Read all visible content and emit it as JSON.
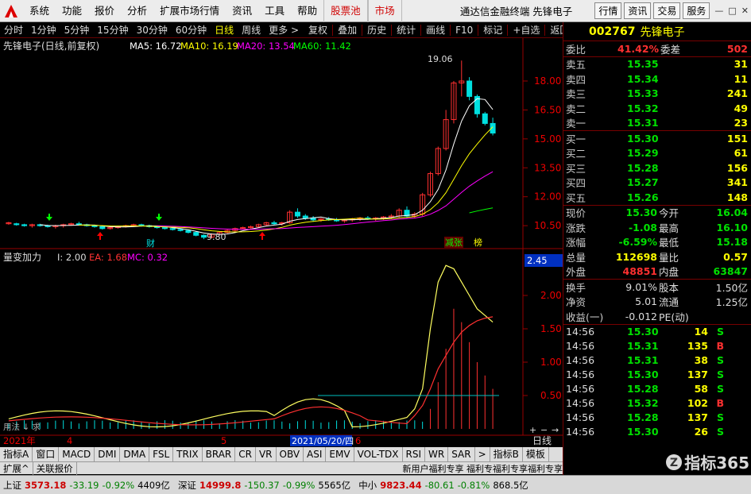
{
  "menu": {
    "items": [
      "系统",
      "功能",
      "报价",
      "分析",
      "扩展市场行情",
      "资讯",
      "工具",
      "帮助"
    ],
    "red_items": [
      "股票池",
      "市场"
    ],
    "title": "通达信金融终端  先锋电子",
    "right_buttons": [
      "行情",
      "资讯",
      "交易",
      "服务"
    ]
  },
  "toolbar": {
    "items": [
      "分时",
      "1分钟",
      "5分钟",
      "15分钟",
      "30分钟",
      "60分钟",
      "日线",
      "周线",
      "更多 >"
    ],
    "selected": "日线",
    "items2": [
      "复权",
      "叠加",
      "历史",
      "统计",
      "画线",
      "F10",
      "标记",
      "+自选",
      "返回"
    ]
  },
  "chart": {
    "title": "先锋电子(日线,前复权)",
    "ma5": "MA5: 16.72",
    "ma10": "MA10: 16.19",
    "ma20": "MA20: 13.54",
    "ma60": "MA60: 11.42",
    "price_ticks": [
      "18.00",
      "16.50",
      "15.00",
      "13.50",
      "12.00",
      "10.50"
    ],
    "high_label": "19.06",
    "low_label": "9.80",
    "cai_label": "财",
    "tag1": "减张",
    "tag2": "榜",
    "ind_title": "量变加力",
    "ind_i": "I: 2.00",
    "ind_ea": "EA: 1.68",
    "ind_mc": "MC: 0.32",
    "ind_ticks": [
      "2.00",
      "1.50",
      "1.00",
      "0.50"
    ],
    "ind_top": "2.45",
    "date_labels": [
      "2021年",
      "4",
      "5",
      "6"
    ],
    "date_box": "2021/05/20/四",
    "period": "日线",
    "bottom_label": "用法 ↓ 求",
    "bottom_icons": [
      "+",
      "−",
      "→"
    ]
  },
  "chart_data": {
    "type": "candlestick",
    "candles": [
      [
        10.6,
        10.7,
        10.55,
        10.65
      ],
      [
        10.6,
        10.65,
        10.5,
        10.55
      ],
      [
        10.55,
        10.6,
        10.45,
        10.5
      ],
      [
        10.5,
        10.6,
        10.4,
        10.55
      ],
      [
        10.55,
        10.6,
        10.45,
        10.5
      ],
      [
        10.5,
        10.55,
        10.4,
        10.45
      ],
      [
        10.45,
        10.55,
        10.35,
        10.5
      ],
      [
        10.5,
        10.6,
        10.4,
        10.55
      ],
      [
        10.55,
        10.65,
        10.5,
        10.6
      ],
      [
        10.6,
        10.7,
        10.5,
        10.55
      ],
      [
        10.55,
        10.6,
        10.45,
        10.5
      ],
      [
        10.5,
        10.55,
        10.4,
        10.45
      ],
      [
        10.45,
        10.5,
        10.3,
        10.35
      ],
      [
        10.35,
        10.45,
        10.3,
        10.4
      ],
      [
        10.4,
        10.5,
        10.35,
        10.45
      ],
      [
        10.45,
        10.55,
        10.4,
        10.5
      ],
      [
        10.5,
        10.6,
        10.45,
        10.55
      ],
      [
        10.55,
        10.6,
        10.45,
        10.5
      ],
      [
        10.5,
        10.55,
        10.4,
        10.45
      ],
      [
        10.45,
        10.5,
        10.35,
        10.4
      ],
      [
        10.4,
        10.45,
        10.3,
        10.35
      ],
      [
        10.35,
        10.4,
        10.25,
        10.3
      ],
      [
        10.3,
        10.35,
        10.2,
        10.25
      ],
      [
        10.25,
        10.3,
        10.1,
        10.15
      ],
      [
        10.15,
        10.2,
        9.95,
        10.0
      ],
      [
        10.0,
        10.05,
        9.8,
        9.9
      ],
      [
        9.9,
        10.1,
        9.85,
        10.05
      ],
      [
        10.05,
        10.2,
        10.0,
        10.15
      ],
      [
        10.15,
        10.3,
        10.1,
        10.25
      ],
      [
        10.25,
        10.4,
        10.2,
        10.35
      ],
      [
        10.35,
        10.45,
        10.3,
        10.4
      ],
      [
        10.4,
        10.5,
        10.35,
        10.45
      ],
      [
        10.45,
        10.6,
        10.4,
        10.55
      ],
      [
        10.55,
        10.7,
        10.5,
        10.65
      ],
      [
        10.65,
        10.75,
        10.55,
        10.6
      ],
      [
        10.6,
        10.7,
        10.5,
        10.65
      ],
      [
        10.65,
        11.3,
        10.6,
        11.2
      ],
      [
        11.2,
        11.4,
        10.9,
        11.0
      ],
      [
        11.0,
        11.1,
        10.8,
        10.9
      ],
      [
        10.9,
        11.0,
        10.7,
        10.8
      ],
      [
        10.8,
        10.9,
        10.7,
        10.85
      ],
      [
        10.85,
        10.95,
        10.75,
        10.8
      ],
      [
        10.8,
        10.9,
        10.7,
        10.75
      ],
      [
        10.75,
        10.85,
        10.65,
        10.8
      ],
      [
        10.8,
        10.9,
        10.7,
        10.85
      ],
      [
        10.85,
        10.95,
        10.75,
        10.9
      ],
      [
        10.9,
        11.0,
        10.8,
        10.85
      ],
      [
        10.85,
        10.95,
        10.75,
        10.9
      ],
      [
        10.9,
        11.0,
        10.8,
        10.95
      ],
      [
        10.95,
        11.1,
        10.85,
        11.0
      ],
      [
        11.0,
        11.4,
        10.9,
        11.3
      ],
      [
        11.3,
        11.5,
        10.9,
        11.0
      ],
      [
        11.0,
        11.2,
        10.9,
        11.1
      ],
      [
        11.1,
        12.2,
        11.0,
        12.1
      ],
      [
        12.1,
        13.3,
        12.0,
        13.2
      ],
      [
        13.2,
        14.6,
        13.1,
        14.5
      ],
      [
        14.5,
        16.5,
        14.4,
        16.0
      ],
      [
        16.0,
        18.0,
        15.8,
        17.9
      ],
      [
        17.9,
        19.06,
        17.2,
        18.0
      ],
      [
        18.0,
        18.2,
        17.0,
        17.2
      ],
      [
        17.2,
        17.3,
        16.1,
        16.3
      ],
      [
        16.3,
        16.4,
        15.7,
        15.8
      ],
      [
        15.8,
        16.1,
        15.18,
        15.3
      ]
    ]
  },
  "quote": {
    "code": "002767",
    "name": "先锋电子",
    "wei": {
      "l1": "委比",
      "v1": "41.42%",
      "l2": "委差",
      "v2": "502"
    },
    "sell": [
      {
        "l": "卖五",
        "p": "15.35",
        "q": "31"
      },
      {
        "l": "卖四",
        "p": "15.34",
        "q": "11"
      },
      {
        "l": "卖三",
        "p": "15.33",
        "q": "241"
      },
      {
        "l": "卖二",
        "p": "15.32",
        "q": "49"
      },
      {
        "l": "卖一",
        "p": "15.31",
        "q": "23"
      }
    ],
    "buy": [
      {
        "l": "买一",
        "p": "15.30",
        "q": "151"
      },
      {
        "l": "买二",
        "p": "15.29",
        "q": "61"
      },
      {
        "l": "买三",
        "p": "15.28",
        "q": "156"
      },
      {
        "l": "买四",
        "p": "15.27",
        "q": "341"
      },
      {
        "l": "买五",
        "p": "15.26",
        "q": "148"
      }
    ],
    "stats": [
      {
        "l1": "现价",
        "v1": "15.30",
        "c1": "g",
        "l2": "今开",
        "v2": "16.04",
        "c2": "g"
      },
      {
        "l1": "涨跌",
        "v1": "-1.08",
        "c1": "g",
        "l2": "最高",
        "v2": "16.10",
        "c2": "g"
      },
      {
        "l1": "涨幅",
        "v1": "-6.59%",
        "c1": "g",
        "l2": "最低",
        "v2": "15.18",
        "c2": "g"
      },
      {
        "l1": "总量",
        "v1": "112698",
        "c1": "y",
        "l2": "量比",
        "v2": "0.57",
        "c2": "y"
      },
      {
        "l1": "外盘",
        "v1": "48851",
        "c1": "r",
        "l2": "内盘",
        "v2": "63847",
        "c2": "g"
      }
    ],
    "stats2": [
      {
        "l1": "换手",
        "v1": "9.01%",
        "l2": "股本",
        "v2": "1.50亿"
      },
      {
        "l1": "净资",
        "v1": "5.01",
        "l2": "流通",
        "v2": "1.25亿"
      },
      {
        "l1": "收益(一)",
        "v1": "-0.012",
        "l2": "PE(动)",
        "v2": ""
      }
    ],
    "ticks": [
      {
        "t": "14:56",
        "p": "15.30",
        "q": "14",
        "s": "S"
      },
      {
        "t": "14:56",
        "p": "15.31",
        "q": "135",
        "s": "B"
      },
      {
        "t": "14:56",
        "p": "15.31",
        "q": "38",
        "s": "S"
      },
      {
        "t": "14:56",
        "p": "15.30",
        "q": "137",
        "s": "S"
      },
      {
        "t": "14:56",
        "p": "15.28",
        "q": "58",
        "s": "S"
      },
      {
        "t": "14:56",
        "p": "15.32",
        "q": "102",
        "s": "B"
      },
      {
        "t": "14:56",
        "p": "15.28",
        "q": "137",
        "s": "S"
      },
      {
        "t": "14:56",
        "p": "15.30",
        "q": "26",
        "s": "S"
      }
    ],
    "watermark": "指标365"
  },
  "tabs1": [
    "指标A",
    "MACD",
    "DMI",
    "DMA",
    "FSL",
    "TRIX",
    "BRAR",
    "CR",
    "VR",
    "OBV",
    "ASI",
    "EMV",
    "VOL-TDX",
    "RSI",
    "WR",
    "SAR",
    ">",
    "指标B",
    "模板"
  ],
  "tabs1_first": "窗口",
  "tabs2": [
    "扩展^",
    "关联报价"
  ],
  "ticker_msg": "新用户福利专享 福利专福利专享福利专享",
  "status": {
    "sh_label": "上证",
    "sh_val": "3573.18",
    "sh_chg": "-33.19",
    "sh_pct": "-0.92%",
    "sh_amt": "4409亿",
    "sz_label": "深证",
    "sz_val": "14999.8",
    "sz_chg": "-150.37",
    "sz_pct": "-0.99%",
    "sz_amt": "5565亿",
    "zx_label": "中小",
    "zx_val": "9823.44",
    "zx_chg": "-80.61",
    "zx_pct": "-0.81%",
    "zx_amt": "868.5亿"
  }
}
